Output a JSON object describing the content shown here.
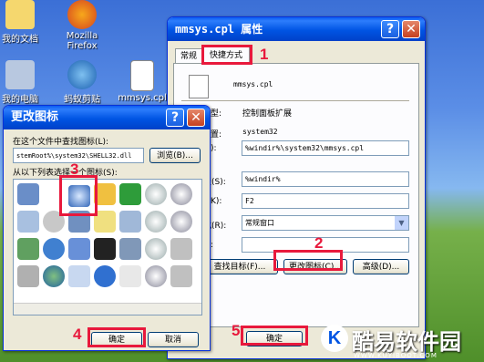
{
  "desktop": {
    "icons": [
      {
        "label": "我的文档"
      },
      {
        "label": "Mozilla Firefox"
      },
      {
        "label": "我的电脑"
      },
      {
        "label": "蚂蚁剪贴"
      },
      {
        "label": "mmsys.cpl"
      }
    ]
  },
  "properties": {
    "title": "mmsys.cpl 属性",
    "tabs": [
      "常规",
      "快捷方式"
    ],
    "file_name": "mmsys.cpl",
    "rows": [
      {
        "label": "型:",
        "value": "控制面板扩展"
      },
      {
        "label": "置:",
        "value": "system32"
      },
      {
        "label": "):",
        "value": "%windir%\\system32\\mmsys.cpl"
      },
      {
        "label": "置(S):",
        "value": "%windir%"
      },
      {
        "label": "K):",
        "value": "F2"
      },
      {
        "label": "式(R):",
        "value": "常规窗口"
      },
      {
        "label": ":",
        "value": ""
      }
    ],
    "buttons": {
      "find_target": "查找目标(F)...",
      "change_icon": "更改图标(C)...",
      "advanced": "高级(D)...",
      "ok": "确定"
    }
  },
  "change_icon": {
    "title": "更改图标",
    "file_label": "在这个文件中查找图标(L):",
    "file_value": "stemRoot%\\system32\\SHELL32.dll",
    "browse": "浏览(B)...",
    "list_label": "从以下列表选择一个图标(S):",
    "ok": "确定",
    "cancel": "取消"
  },
  "steps": [
    "1",
    "2",
    "3",
    "4",
    "5"
  ],
  "watermark": {
    "text": "酷易软件园",
    "url": "WWW.KUYIBOOT.COM",
    "logo": "K"
  }
}
